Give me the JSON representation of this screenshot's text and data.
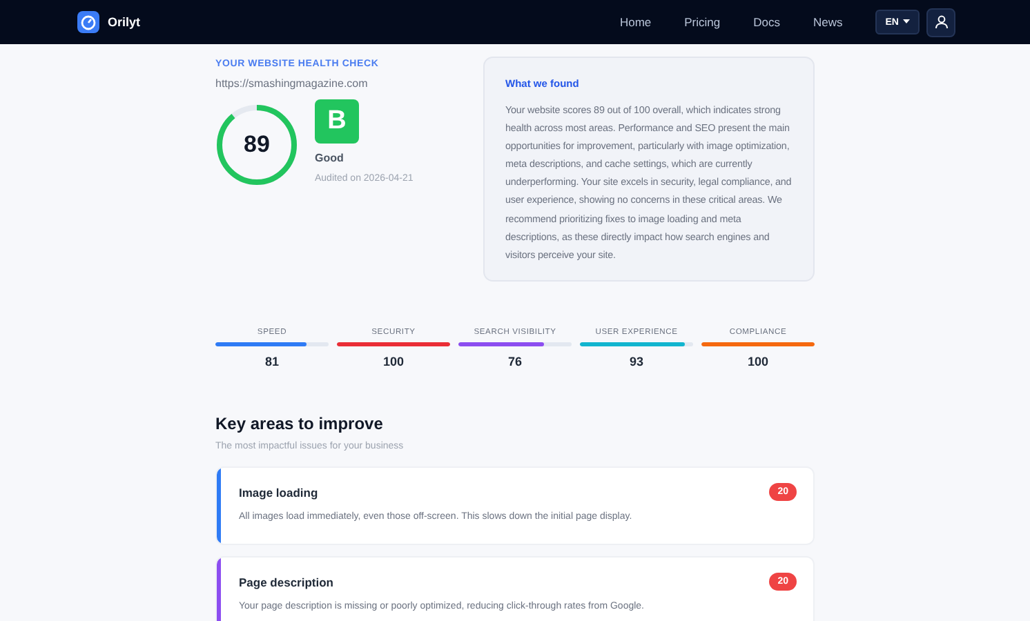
{
  "nav": {
    "brand": "Orilyt",
    "links": [
      "Home",
      "Pricing",
      "Docs",
      "News"
    ],
    "language": "EN"
  },
  "health": {
    "eyebrow": "YOUR WEBSITE HEALTH CHECK",
    "url": "https://smashingmagazine.com",
    "score": "89",
    "grade": "B",
    "rating": "Good",
    "audited": "Audited on 2026-04-21"
  },
  "findings": {
    "title": "What we found",
    "text": "Your website scores 89 out of 100 overall, which indicates strong health across most areas. Performance and SEO present the main opportunities for improvement, particularly with image optimization, meta descriptions, and cache settings, which are currently underperforming. Your site excels in security, legal compliance, and user experience, showing no concerns in these critical areas. We recommend prioritizing fixes to image loading and meta descriptions, as these directly impact how search engines and visitors perceive your site."
  },
  "metrics": [
    {
      "label": "SPEED",
      "value": "81",
      "level": 0.81,
      "color": "#2f7bf5"
    },
    {
      "label": "SECURITY",
      "value": "100",
      "level": 1,
      "color": "#ea2e36"
    },
    {
      "label": "SEARCH VISIBILITY",
      "value": "76",
      "level": 0.76,
      "color": "#8c4ef0"
    },
    {
      "label": "USER EXPERIENCE",
      "value": "93",
      "level": 0.93,
      "color": "#12b5cf"
    },
    {
      "label": "COMPLIANCE",
      "value": "100",
      "level": 1,
      "color": "#f5690f"
    }
  ],
  "improve": {
    "title": "Key areas to improve",
    "subtitle": "The most impactful issues for your business",
    "issues": [
      {
        "title": "Image loading",
        "text": "All images load immediately, even those off-screen. This slows down the initial page display.",
        "points": "20",
        "color": "#2f7bf5"
      },
      {
        "title": "Page description",
        "text": "Your page description is missing or poorly optimized, reducing click-through rates from Google.",
        "points": "20",
        "color": "#8c4ef0"
      }
    ]
  }
}
